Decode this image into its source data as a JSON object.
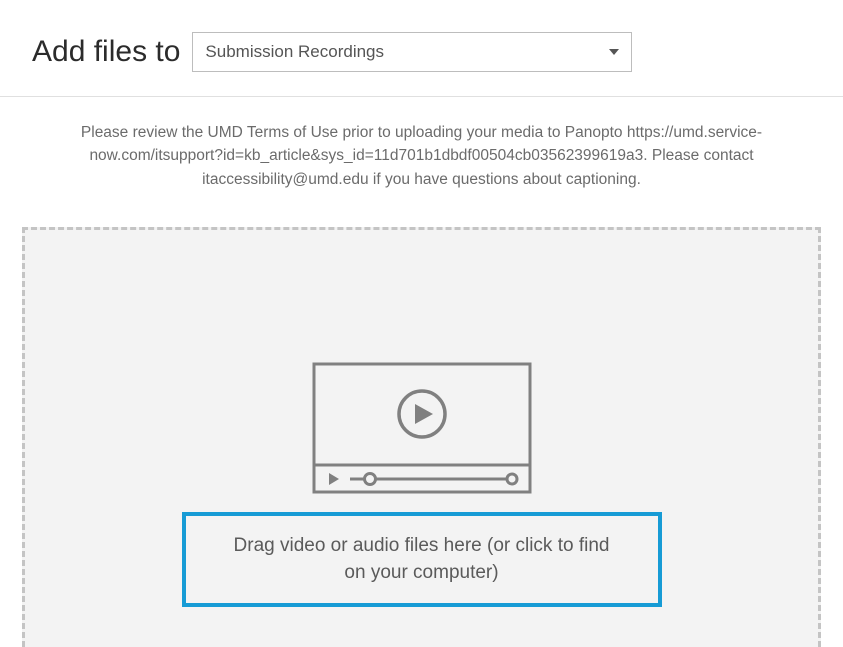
{
  "header": {
    "title": "Add files to",
    "selected_folder": "Submission Recordings"
  },
  "terms": {
    "text": "Please review the UMD Terms of Use prior to uploading your media to Panopto https://umd.service-now.com/itsupport?id=kb_article&sys_id=11d701b1dbdf00504cb03562399619a3. Please contact itaccessibility@umd.edu if you have questions about captioning."
  },
  "dropzone": {
    "label": "Drag video or audio files here (or click to find on your computer)"
  }
}
